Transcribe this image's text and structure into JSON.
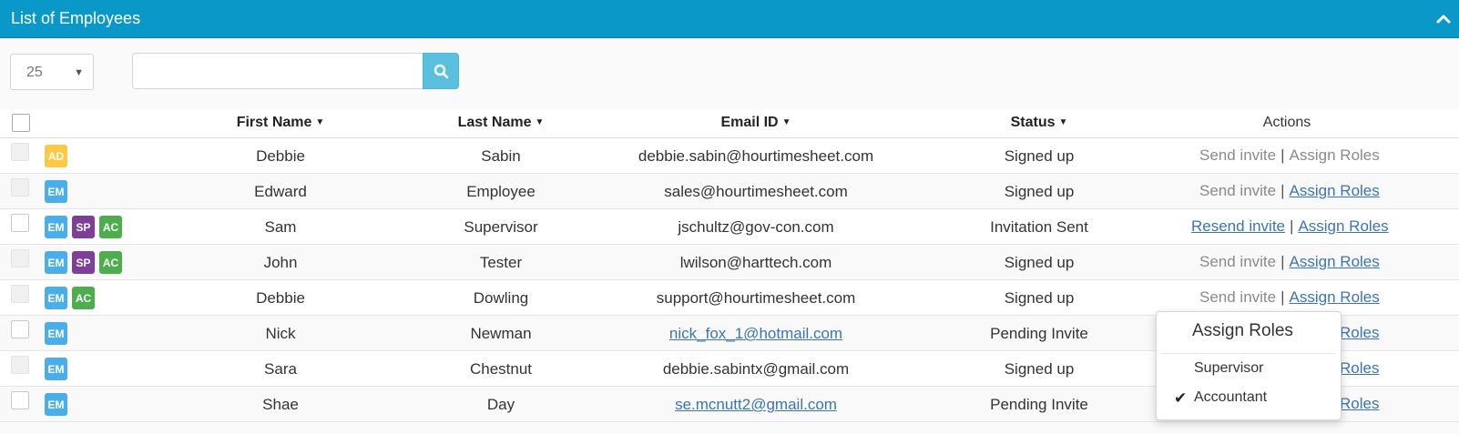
{
  "panel": {
    "title": "List of Employees"
  },
  "controls": {
    "page_size": "25",
    "search_value": ""
  },
  "table": {
    "headers": {
      "first_name": "First Name",
      "last_name": "Last Name",
      "email": "Email ID",
      "status": "Status",
      "actions": "Actions"
    },
    "separator": "|",
    "rows": [
      {
        "roles": [
          "AD"
        ],
        "first": "Debbie",
        "last": "Sabin",
        "email": "debbie.sabin@hourtimesheet.com",
        "email_link": false,
        "status": "Signed up",
        "invite": "Send invite",
        "invite_link": false,
        "assign": "Assign Roles",
        "assign_link": false,
        "checkbox_disabled": true
      },
      {
        "roles": [
          "EM"
        ],
        "first": "Edward",
        "last": "Employee",
        "email": "sales@hourtimesheet.com",
        "email_link": false,
        "status": "Signed up",
        "invite": "Send invite",
        "invite_link": false,
        "assign": "Assign Roles",
        "assign_link": true,
        "checkbox_disabled": true
      },
      {
        "roles": [
          "EM",
          "SP",
          "AC"
        ],
        "first": "Sam",
        "last": "Supervisor",
        "email": "jschultz@gov-con.com",
        "email_link": false,
        "status": "Invitation Sent",
        "invite": "Resend invite",
        "invite_link": true,
        "assign": "Assign Roles",
        "assign_link": true,
        "checkbox_disabled": false
      },
      {
        "roles": [
          "EM",
          "SP",
          "AC"
        ],
        "first": "John",
        "last": "Tester",
        "email": "lwilson@harttech.com",
        "email_link": false,
        "status": "Signed up",
        "invite": "Send invite",
        "invite_link": false,
        "assign": "Assign Roles",
        "assign_link": true,
        "checkbox_disabled": true
      },
      {
        "roles": [
          "EM",
          "AC"
        ],
        "first": "Debbie",
        "last": "Dowling",
        "email": "support@hourtimesheet.com",
        "email_link": false,
        "status": "Signed up",
        "invite": "Send invite",
        "invite_link": false,
        "assign": "Assign Roles",
        "assign_link": true,
        "checkbox_disabled": true
      },
      {
        "roles": [
          "EM"
        ],
        "first": "Nick",
        "last": "Newman",
        "email": "nick_fox_1@hotmail.com",
        "email_link": true,
        "status": "Pending Invite",
        "invite": "",
        "invite_link": false,
        "assign": "Roles",
        "assign_link": true,
        "checkbox_disabled": false
      },
      {
        "roles": [
          "EM"
        ],
        "first": "Sara",
        "last": "Chestnut",
        "email": "debbie.sabintx@gmail.com",
        "email_link": false,
        "status": "Signed up",
        "invite": "",
        "invite_link": false,
        "assign": "Roles",
        "assign_link": true,
        "checkbox_disabled": true
      },
      {
        "roles": [
          "EM"
        ],
        "first": "Shae",
        "last": "Day",
        "email": "se.mcnutt2@gmail.com",
        "email_link": true,
        "status": "Pending Invite",
        "invite": "",
        "invite_link": false,
        "assign": "Roles",
        "assign_link": true,
        "checkbox_disabled": false
      }
    ]
  },
  "roles_dropdown": {
    "title": "Assign Roles",
    "items": [
      {
        "label": "Supervisor",
        "checked": false
      },
      {
        "label": "Accountant",
        "checked": true
      }
    ],
    "check_glyph": "✔"
  }
}
